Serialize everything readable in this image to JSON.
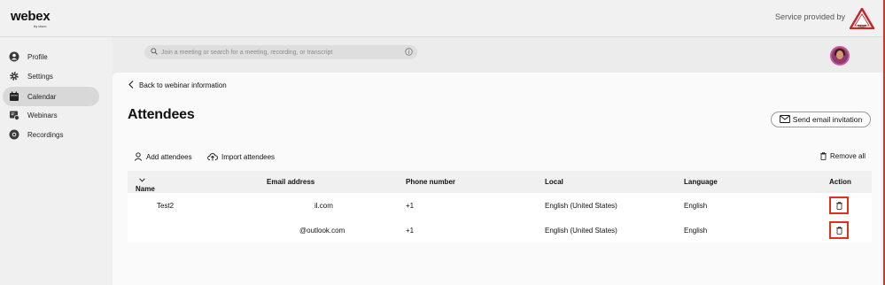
{
  "header": {
    "brand": "webex",
    "brand_sub": "by cisco",
    "service_text": "Service provided by",
    "logo_badge": "TEST"
  },
  "sidebar": {
    "items": [
      {
        "label": "Profile",
        "icon": "profile-icon",
        "active": false
      },
      {
        "label": "Settings",
        "icon": "gear-icon",
        "active": false
      },
      {
        "label": "Calendar",
        "icon": "calendar-icon",
        "active": true
      },
      {
        "label": "Webinars",
        "icon": "webinar-icon",
        "active": false
      },
      {
        "label": "Recordings",
        "icon": "recordings-icon",
        "active": false
      }
    ]
  },
  "search": {
    "placeholder": "Join a meeting or search for a meeting, recording, or transcript"
  },
  "page": {
    "back_label": "Back to webinar information",
    "title": "Attendees",
    "send_email_label": "Send email invitation",
    "add_attendees_label": "Add attendees",
    "import_attendees_label": "Import attendees",
    "remove_all_label": "Remove all"
  },
  "table": {
    "columns": [
      "Name",
      "Email address",
      "Phone number",
      "Local",
      "Language",
      "Action"
    ],
    "rows": [
      {
        "name": "Test2",
        "email": "il.com",
        "phone": "+1",
        "local": "English (United States)",
        "language": "English"
      },
      {
        "name": "",
        "email": "@outlook.com",
        "phone": "+1",
        "local": "English (United States)",
        "language": "English"
      }
    ]
  },
  "colors": {
    "accent_red": "#e0301e",
    "active_nav": "#d8d8d8",
    "background": "#ececec"
  }
}
